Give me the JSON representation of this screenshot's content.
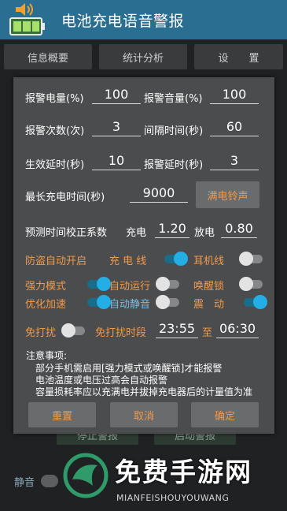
{
  "header": {
    "title": "电池充电语音警报",
    "icon": "battery-speaker-icon"
  },
  "tabs": [
    {
      "label": "信息概要"
    },
    {
      "label": "统计分析"
    },
    {
      "label": "设　　置"
    }
  ],
  "background": {
    "stop_button": "停止警报",
    "start_button": "启动警报",
    "mute_label": "静音"
  },
  "dialog": {
    "rows": {
      "alarm_level_label": "报警电量(%)",
      "alarm_level_value": "100",
      "alarm_volume_label": "报警音量(%)",
      "alarm_volume_value": "100",
      "alarm_count_label": "报警次数(次)",
      "alarm_count_value": "3",
      "interval_label": "间隔时间(秒)",
      "interval_value": "60",
      "effect_delay_label": "生效延时(秒)",
      "effect_delay_value": "10",
      "alarm_delay_label": "报警延时(秒)",
      "alarm_delay_value": "3",
      "max_charge_label": "最长充电时间(秒)",
      "max_charge_value": "9000",
      "full_ring_button": "满电铃声",
      "correction_label": "预测时间校正系数",
      "charge_label": "充电",
      "charge_value": "1.20",
      "discharge_label": "放电",
      "discharge_value": "0.80"
    },
    "switches": {
      "anti_theft": "防盗自动开启",
      "charge_cable": "充 电 线",
      "headphone": "耳机线",
      "strong_mode": "强力模式",
      "auto_run": "自动运行",
      "wake_lock": "唤醒锁",
      "optimize": "优化加速",
      "auto_mute": "自动静音",
      "vibrate": "震　动",
      "dnd": "免打扰",
      "dnd_period": "免打扰时段",
      "dnd_start": "23:55",
      "to": "至",
      "dnd_end": "06:30"
    },
    "notes": {
      "title": "注意事项:",
      "lines": [
        "部分手机需启用[强力模式或唤醒锁]才能报警",
        "电池温度或电压过高会自动报警",
        "容量损耗率应以充满电并拔掉充电器后的计量值为准"
      ]
    },
    "buttons": {
      "reset": "重置",
      "cancel": "取消",
      "confirm": "确定"
    }
  },
  "watermark": {
    "title": "免费手游网",
    "subtitle": "MIANFEISHOUYOUWANG"
  },
  "colors": {
    "header": "#2a6e92",
    "accent_orange": "#f19a4a",
    "toggle_on": "#23aee5",
    "dialog_bg": "#4b4c4e"
  }
}
